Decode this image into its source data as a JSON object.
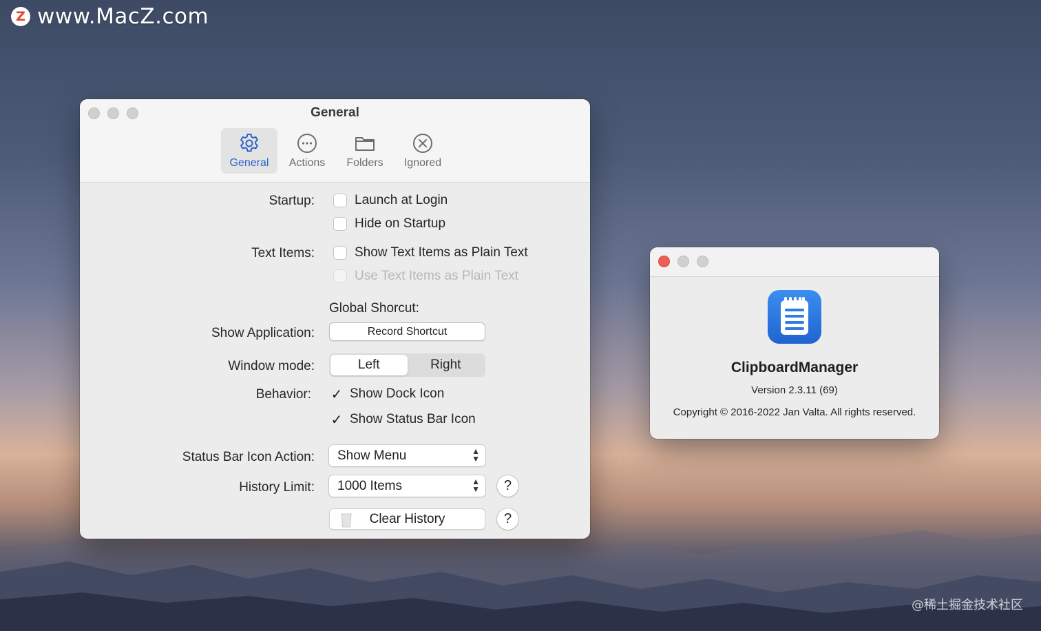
{
  "watermark": {
    "logo": "Z",
    "site": "www.MacZ.com",
    "corner": "@稀土掘金技术社区"
  },
  "prefs_window": {
    "title": "General",
    "toolbar": [
      {
        "label": "General",
        "icon": "gear-icon",
        "selected": true
      },
      {
        "label": "Actions",
        "icon": "ellipsis-circle-icon",
        "selected": false
      },
      {
        "label": "Folders",
        "icon": "folder-icon",
        "selected": false
      },
      {
        "label": "Ignored",
        "icon": "x-circle-icon",
        "selected": false
      }
    ],
    "startup": {
      "label": "Startup:",
      "launch_at_login": {
        "label": "Launch at Login",
        "checked": false
      },
      "hide_on_startup": {
        "label": "Hide on Startup",
        "checked": false
      }
    },
    "text_items": {
      "label": "Text Items:",
      "show_plain": {
        "label": "Show Text Items as Plain Text",
        "checked": false
      },
      "use_plain": {
        "label": "Use Text Items as Plain Text",
        "checked": false,
        "disabled": true
      }
    },
    "global_shortcut": {
      "heading": "Global Shorcut:",
      "label": "Show Application:",
      "button": "Record Shortcut"
    },
    "window_mode": {
      "label": "Window mode:",
      "options": [
        "Left",
        "Right"
      ],
      "selected": "Left"
    },
    "behavior": {
      "label": "Behavior:",
      "show_dock_icon": {
        "label": "Show Dock Icon",
        "checked": true
      },
      "show_status_bar_icon": {
        "label": "Show Status Bar Icon",
        "checked": true
      }
    },
    "status_bar_action": {
      "label": "Status Bar Icon Action:",
      "value": "Show Menu"
    },
    "history_limit": {
      "label": "History Limit:",
      "value": "1000 Items",
      "help": "?"
    },
    "clear_history": {
      "button": "Clear History",
      "help": "?"
    }
  },
  "about_window": {
    "app_name": "ClipboardManager",
    "version": "Version 2.3.11 (69)",
    "copyright": "Copyright © 2016-2022 Jan Valta. All rights reserved."
  },
  "colors": {
    "accent": "#2a62c9",
    "close_red": "#ee5e56",
    "app_icon_blue": "#2f7de1"
  }
}
